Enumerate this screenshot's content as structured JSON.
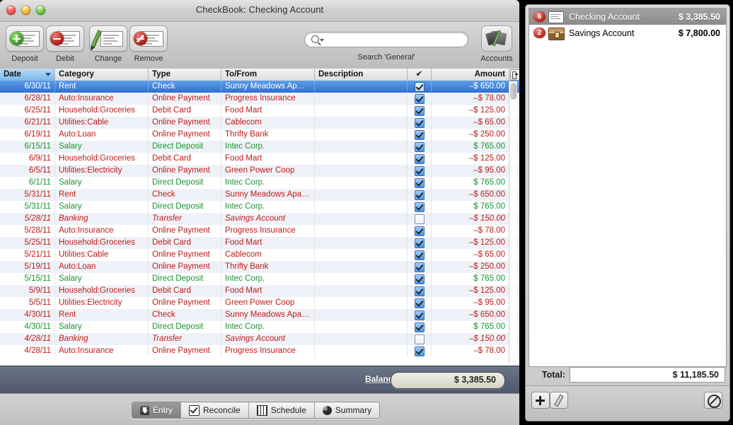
{
  "window": {
    "title": "CheckBook:  Checking Account",
    "traffic_lights": [
      "close-button",
      "minimize-button",
      "zoom-button"
    ]
  },
  "toolbar": {
    "buttons": [
      {
        "label": "Deposit",
        "icon": "deposit-check-icon"
      },
      {
        "label": "Debit",
        "icon": "debit-check-icon"
      },
      {
        "label": "Change",
        "icon": "change-check-icon"
      },
      {
        "label": "Remove",
        "icon": "remove-check-icon"
      }
    ],
    "search": {
      "value": "",
      "placeholder": "",
      "caption": "Search 'General'",
      "icon": "search-icon"
    },
    "accounts": {
      "label": "Accounts",
      "icon": "accounts-icon"
    }
  },
  "table": {
    "columns": [
      {
        "key": "date",
        "label": "Date",
        "sorted": true,
        "sort_dir": "descending"
      },
      {
        "key": "category",
        "label": "Category"
      },
      {
        "key": "type",
        "label": "Type"
      },
      {
        "key": "tofrom",
        "label": "To/From"
      },
      {
        "key": "description",
        "label": "Description"
      },
      {
        "key": "cleared",
        "label": "✔"
      },
      {
        "key": "amount",
        "label": "Amount"
      }
    ],
    "column_menu_icon": "column-options-icon",
    "rows": [
      {
        "date": "6/30/11",
        "category": "Rent",
        "type": "Check",
        "tofrom": "Sunny Meadows Ap…",
        "description": "",
        "cleared": true,
        "amount": "–$ 650.00",
        "sign": "neg",
        "selected": true,
        "italic": false
      },
      {
        "date": "6/28/11",
        "category": "Auto:Insurance",
        "type": "Online Payment",
        "tofrom": "Progress Insurance",
        "description": "",
        "cleared": true,
        "amount": "–$ 78.00",
        "sign": "neg",
        "selected": false,
        "italic": false
      },
      {
        "date": "6/25/11",
        "category": "Household:Groceries",
        "type": "Debit Card",
        "tofrom": "Food Mart",
        "description": "",
        "cleared": true,
        "amount": "–$ 125.00",
        "sign": "neg",
        "selected": false,
        "italic": false
      },
      {
        "date": "6/21/11",
        "category": "Utilities:Cable",
        "type": "Online Payment",
        "tofrom": "Cablecom",
        "description": "",
        "cleared": true,
        "amount": "–$ 65.00",
        "sign": "neg",
        "selected": false,
        "italic": false
      },
      {
        "date": "6/19/11",
        "category": "Auto:Loan",
        "type": "Online Payment",
        "tofrom": "Thrifty Bank",
        "description": "",
        "cleared": true,
        "amount": "–$ 250.00",
        "sign": "neg",
        "selected": false,
        "italic": false
      },
      {
        "date": "6/15/11",
        "category": "Salary",
        "type": "Direct Deposit",
        "tofrom": "Intec Corp.",
        "description": "",
        "cleared": true,
        "amount": "$ 765.00",
        "sign": "pos",
        "selected": false,
        "italic": false
      },
      {
        "date": "6/9/11",
        "category": "Household:Groceries",
        "type": "Debit Card",
        "tofrom": "Food Mart",
        "description": "",
        "cleared": true,
        "amount": "–$ 125.00",
        "sign": "neg",
        "selected": false,
        "italic": false
      },
      {
        "date": "6/5/11",
        "category": "Utilities:Electricity",
        "type": "Online Payment",
        "tofrom": "Green Power Coop",
        "description": "",
        "cleared": true,
        "amount": "–$ 95.00",
        "sign": "neg",
        "selected": false,
        "italic": false
      },
      {
        "date": "6/1/11",
        "category": "Salary",
        "type": "Direct Deposit",
        "tofrom": "Intec Corp.",
        "description": "",
        "cleared": true,
        "amount": "$ 765.00",
        "sign": "pos",
        "selected": false,
        "italic": false
      },
      {
        "date": "5/31/11",
        "category": "Rent",
        "type": "Check",
        "tofrom": "Sunny Meadows Apa…",
        "description": "",
        "cleared": true,
        "amount": "–$ 650.00",
        "sign": "neg",
        "selected": false,
        "italic": false
      },
      {
        "date": "5/31/11",
        "category": "Salary",
        "type": "Direct Deposit",
        "tofrom": "Intec Corp.",
        "description": "",
        "cleared": true,
        "amount": "$ 765.00",
        "sign": "pos",
        "selected": false,
        "italic": false
      },
      {
        "date": "5/28/11",
        "category": "Banking",
        "type": "Transfer",
        "tofrom": "Savings Account",
        "description": "",
        "cleared": false,
        "amount": "–$ 150.00",
        "sign": "neg",
        "selected": false,
        "italic": true
      },
      {
        "date": "5/28/11",
        "category": "Auto:Insurance",
        "type": "Online Payment",
        "tofrom": "Progress Insurance",
        "description": "",
        "cleared": true,
        "amount": "–$ 78.00",
        "sign": "neg",
        "selected": false,
        "italic": false
      },
      {
        "date": "5/25/11",
        "category": "Household:Groceries",
        "type": "Debit Card",
        "tofrom": "Food Mart",
        "description": "",
        "cleared": true,
        "amount": "–$ 125.00",
        "sign": "neg",
        "selected": false,
        "italic": false
      },
      {
        "date": "5/21/11",
        "category": "Utilities:Cable",
        "type": "Online Payment",
        "tofrom": "Cablecom",
        "description": "",
        "cleared": true,
        "amount": "–$ 65.00",
        "sign": "neg",
        "selected": false,
        "italic": false
      },
      {
        "date": "5/19/11",
        "category": "Auto:Loan",
        "type": "Online Payment",
        "tofrom": "Thrifty Bank",
        "description": "",
        "cleared": true,
        "amount": "–$ 250.00",
        "sign": "neg",
        "selected": false,
        "italic": false
      },
      {
        "date": "5/15/11",
        "category": "Salary",
        "type": "Direct Deposit",
        "tofrom": "Intec Corp.",
        "description": "",
        "cleared": true,
        "amount": "$ 765.00",
        "sign": "pos",
        "selected": false,
        "italic": false
      },
      {
        "date": "5/9/11",
        "category": "Household:Groceries",
        "type": "Debit Card",
        "tofrom": "Food Mart",
        "description": "",
        "cleared": true,
        "amount": "–$ 125.00",
        "sign": "neg",
        "selected": false,
        "italic": false
      },
      {
        "date": "5/5/11",
        "category": "Utilities:Electricity",
        "type": "Online Payment",
        "tofrom": "Green Power Coop",
        "description": "",
        "cleared": true,
        "amount": "–$ 95.00",
        "sign": "neg",
        "selected": false,
        "italic": false
      },
      {
        "date": "4/30/11",
        "category": "Rent",
        "type": "Check",
        "tofrom": "Sunny Meadows Apa…",
        "description": "",
        "cleared": true,
        "amount": "–$ 650.00",
        "sign": "neg",
        "selected": false,
        "italic": false
      },
      {
        "date": "4/30/11",
        "category": "Salary",
        "type": "Direct Deposit",
        "tofrom": "Intec Corp.",
        "description": "",
        "cleared": true,
        "amount": "$ 765.00",
        "sign": "pos",
        "selected": false,
        "italic": false
      },
      {
        "date": "4/28/11",
        "category": "Banking",
        "type": "Transfer",
        "tofrom": "Savings Account",
        "description": "",
        "cleared": false,
        "amount": "–$ 150.00",
        "sign": "neg",
        "selected": false,
        "italic": true
      },
      {
        "date": "4/28/11",
        "category": "Auto:Insurance",
        "type": "Online Payment",
        "tofrom": "Progress Insurance",
        "description": "",
        "cleared": true,
        "amount": "–$ 78.00",
        "sign": "neg",
        "selected": false,
        "italic": false
      }
    ]
  },
  "balance_bar": {
    "label": "Balance",
    "value": "$ 3,385.50",
    "menu_icon": "chevron-down-icon"
  },
  "view_tabs": [
    {
      "label": "Entry",
      "icon": "entry-icon",
      "active": true
    },
    {
      "label": "Reconcile",
      "icon": "reconcile-icon",
      "active": false
    },
    {
      "label": "Schedule",
      "icon": "schedule-icon",
      "active": false
    },
    {
      "label": "Summary",
      "icon": "summary-icon",
      "active": false
    }
  ],
  "sidebar": {
    "accounts": [
      {
        "badge": "6",
        "name": "Checking Account",
        "amount": "$ 3,385.50",
        "icon": "check-register-icon",
        "selected": true
      },
      {
        "badge": "2",
        "name": "Savings Account",
        "amount": "$ 7,800.00",
        "icon": "treasure-chest-icon",
        "selected": false
      }
    ],
    "total_label": "Total:",
    "total_value": "$ 11,185.50",
    "buttons": [
      {
        "name": "add-account-button",
        "icon": "plus-icon"
      },
      {
        "name": "edit-account-button",
        "icon": "pencil-icon"
      },
      {
        "name": "delete-account-button",
        "icon": "no-entry-icon"
      }
    ]
  },
  "colors": {
    "negative": "#c01919",
    "positive": "#16962f",
    "selection": "#2f6fd0",
    "badge": "#b31a14"
  }
}
